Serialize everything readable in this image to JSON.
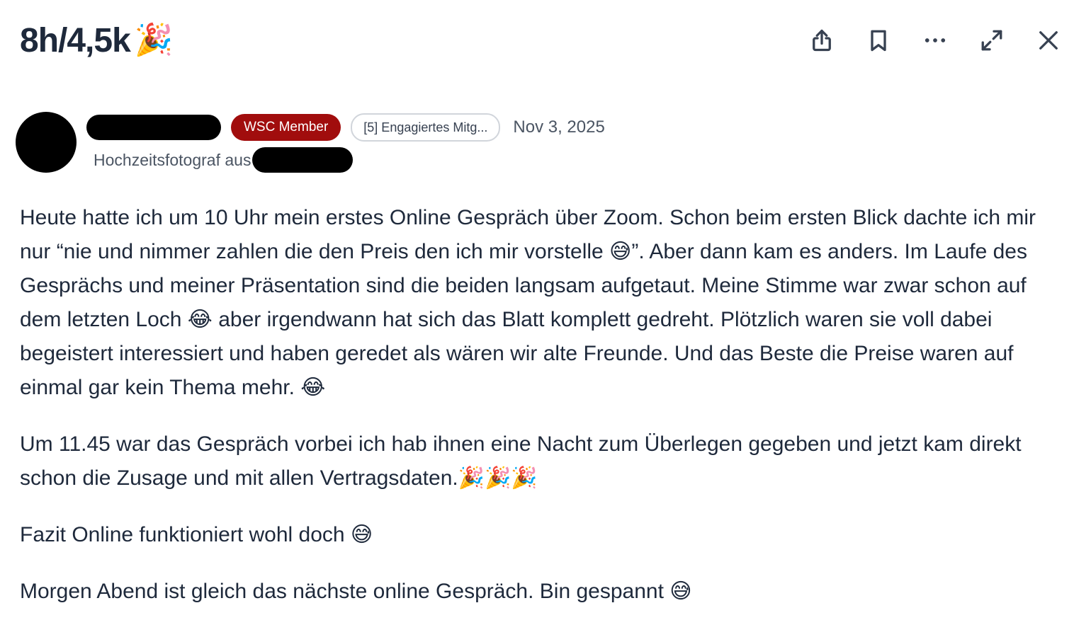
{
  "header": {
    "title": "8h/4,5k",
    "title_emoji": "🎉"
  },
  "actions": {
    "share_icon": "share-icon",
    "bookmark_icon": "bookmark-icon",
    "more_icon": "more-icon",
    "expand_icon": "expand-icon",
    "close_icon": "close-icon"
  },
  "author": {
    "badge_member": "WSC Member",
    "badge_level": "[5] Engagiertes Mitg...",
    "date": "Nov 3, 2025",
    "title": "Hochzeitsfotograf aus"
  },
  "colors": {
    "member_badge": "#a10d0d",
    "text": "#1e293b",
    "muted": "#4b5563"
  },
  "post": {
    "paragraph_1": "Heute hatte ich um 10 Uhr mein erstes Online Gespräch über Zoom. Schon beim ersten Blick dachte ich mir nur “nie und nimmer zahlen die den Preis den ich mir vorstelle 😅”.  Aber dann kam es anders. Im Laufe des Gesprächs und meiner Präsentation sind die beiden langsam aufgetaut. Meine Stimme war zwar schon auf dem letzten Loch 😂 aber irgendwann hat sich das Blatt komplett gedreht. Plötzlich waren sie voll dabei begeistert interessiert und haben geredet als wären wir alte Freunde. Und das Beste die Preise waren auf einmal gar kein Thema mehr.  😂",
    "paragraph_2": "Um 11.45 war das Gespräch vorbei ich hab ihnen eine Nacht zum Überlegen gegeben und jetzt kam direkt schon die Zusage und mit allen Vertragsdaten.🎉🎉🎉",
    "paragraph_3": "Fazit Online funktioniert wohl doch 😅",
    "paragraph_4": "Morgen Abend ist gleich das nächste online Gespräch. Bin gespannt 😅"
  }
}
